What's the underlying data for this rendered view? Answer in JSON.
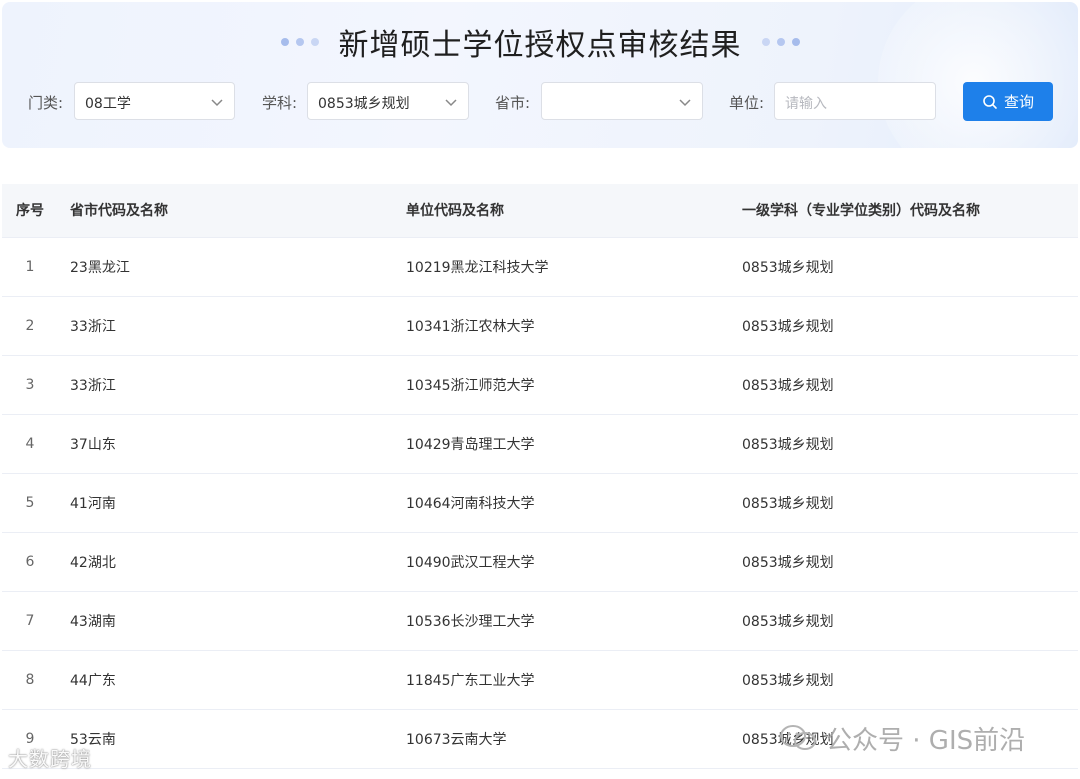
{
  "header": {
    "title": "新增硕士学位授权点审核结果"
  },
  "filters": {
    "category_label": "门类:",
    "category_value": "08工学",
    "subject_label": "学科:",
    "subject_value": "0853城乡规划",
    "province_label": "省市:",
    "province_value": "",
    "unit_label": "单位:",
    "unit_placeholder": "请输入",
    "search_button": "查询"
  },
  "table": {
    "headers": {
      "no": "序号",
      "province": "省市代码及名称",
      "unit": "单位代码及名称",
      "subject": "一级学科（专业学位类别）代码及名称"
    },
    "rows": [
      {
        "no": "1",
        "province": "23黑龙江",
        "unit": "10219黑龙江科技大学",
        "subject": "0853城乡规划"
      },
      {
        "no": "2",
        "province": "33浙江",
        "unit": "10341浙江农林大学",
        "subject": "0853城乡规划"
      },
      {
        "no": "3",
        "province": "33浙江",
        "unit": "10345浙江师范大学",
        "subject": "0853城乡规划"
      },
      {
        "no": "4",
        "province": "37山东",
        "unit": "10429青岛理工大学",
        "subject": "0853城乡规划"
      },
      {
        "no": "5",
        "province": "41河南",
        "unit": "10464河南科技大学",
        "subject": "0853城乡规划"
      },
      {
        "no": "6",
        "province": "42湖北",
        "unit": "10490武汉工程大学",
        "subject": "0853城乡规划"
      },
      {
        "no": "7",
        "province": "43湖南",
        "unit": "10536长沙理工大学",
        "subject": "0853城乡规划"
      },
      {
        "no": "8",
        "province": "44广东",
        "unit": "11845广东工业大学",
        "subject": "0853城乡规划"
      },
      {
        "no": "9",
        "province": "53云南",
        "unit": "10673云南大学",
        "subject": "0853城乡规划"
      }
    ]
  },
  "watermarks": {
    "left": "大数跨境",
    "right": "公众号 · GIS前沿"
  },
  "colors": {
    "accent": "#1e80ea",
    "header_bg": "#eef3fd",
    "table_header_bg": "#f5f7fa"
  },
  "icons": {
    "search_button_icon": "search-icon",
    "select_arrow": "chevron-down-icon",
    "title_decoration": "dot-decoration-icon",
    "watermark_logo": "wechat-icon"
  }
}
